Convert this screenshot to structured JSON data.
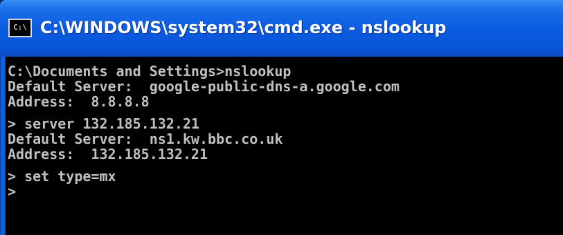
{
  "window": {
    "title": "C:\\WINDOWS\\system32\\cmd.exe - nslookup",
    "icon_name": "cmd-icon",
    "icon_text": "C:\\"
  },
  "console": {
    "lines": [
      "C:\\Documents and Settings>nslookup",
      "Default Server:  google-public-dns-a.google.com",
      "Address:  8.8.8.8",
      "",
      "> server 132.185.132.21",
      "Default Server:  ns1.kw.bbc.co.uk",
      "Address:  132.185.132.21",
      "",
      "> set type=mx",
      ">"
    ]
  },
  "colors": {
    "titlebar": "#0a55d8",
    "console_bg": "#000000",
    "console_text": "#c0c0c0",
    "title_text": "#ffffff"
  }
}
